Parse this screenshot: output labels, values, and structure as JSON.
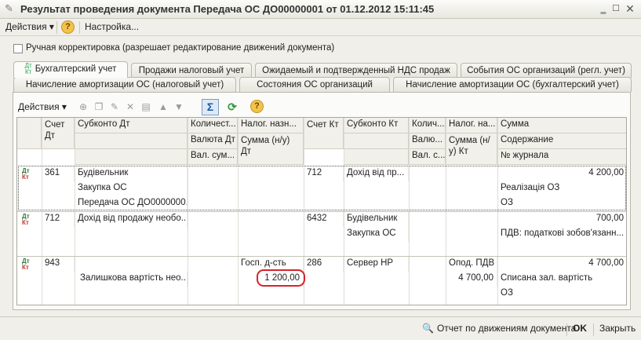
{
  "window": {
    "title": "Результат проведения документа Передача ОС ДО00000001 от 01.12.2012 15:11:45"
  },
  "menubar": {
    "actions_label": "Действия",
    "settings_label": "Настройка..."
  },
  "manual_correction": {
    "label": "Ручная корректировка (разрешает редактирование движений документа)",
    "checked": false
  },
  "tabs_row1": [
    "Бухгалтерский учет",
    "Продажи налоговый учет",
    "Ожидаемый и подтвержденный НДС продаж",
    "События ОС организаций (регл. учет)"
  ],
  "tabs_row2": [
    "Начисление амортизации ОС (налоговый учет)",
    "Состояния ОС организаций",
    "Начисление амортизации ОС (бухгалтерский учет)"
  ],
  "panel_toolbar": {
    "actions_label": "Действия",
    "sigma": "Σ"
  },
  "grid": {
    "headers": {
      "account_dt": "Счет Дт",
      "subconto_dt": "Субконто Дт",
      "quantity": "Количест...",
      "currency_dt": "Валюта Дт",
      "cur_sum_dt": "Вал. сум...",
      "tax_purpose": "Налог. назн...",
      "sum_nu_dt": "Сумма (н/у) Дт",
      "account_kt": "Счет Кт",
      "subconto_kt": "Субконто Кт",
      "qty_kt": "Колич...",
      "currency_kt": "Валю...",
      "cur_sum_kt": "Вал. с...",
      "tax_kt": "Налог. на...",
      "sum_nu_kt": "Сумма (н/у) Кт",
      "amount": "Сумма",
      "content": "Содержание",
      "journal": "№ журнала"
    },
    "rows": [
      {
        "account_dt": "361",
        "subconto_dt": [
          "Будівельник",
          "Закупка ОС",
          "Передача ОС ДО0000000..."
        ],
        "account_kt": "712",
        "subconto_kt": [
          "Дохід від пр..."
        ],
        "amount": "4 200,00",
        "content": "Реалізація ОЗ",
        "journal": "ОЗ"
      },
      {
        "account_dt": "712",
        "subconto_dt": [
          "Дохід від продажу необо..."
        ],
        "account_kt": "6432",
        "subconto_kt": [
          "Будівельник",
          "Закупка ОС"
        ],
        "amount": "700,00",
        "content": "ПДВ: податкові зобов'язанн..."
      },
      {
        "account_dt": "943",
        "subconto_dt_line2": "Залишкова вартість нео...",
        "tax_purpose": "Госп. д-сть",
        "sum_nu_dt": "1 200,00",
        "account_kt": "286",
        "subconto_kt": [
          "Сервер HP"
        ],
        "tax_kt": "Опод. ПДВ",
        "sum_nu_kt": "4 700,00",
        "amount": "4 700,00",
        "content": "Списана зал. вартість",
        "journal": "ОЗ"
      }
    ]
  },
  "statusbar": {
    "report_label": "Отчет по движениям документа",
    "ok_label": "OK",
    "close_label": "Закрыть"
  },
  "colors": {
    "highlight": "#d8232a",
    "accent": "#2f6fb3"
  }
}
